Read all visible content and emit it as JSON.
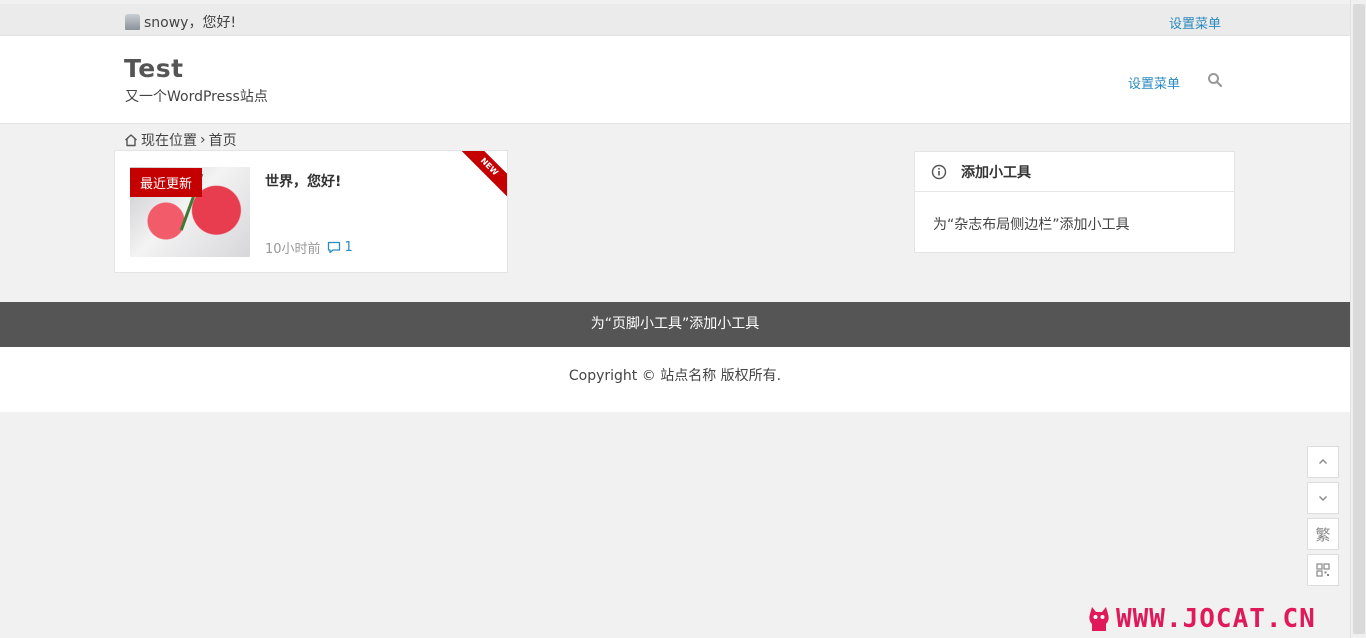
{
  "topbar": {
    "greeting": "snowy，您好!",
    "menu_label": "设置菜单"
  },
  "header": {
    "site_title": "Test",
    "site_description": "又一个WordPress站点",
    "nav_menu_label": "设置菜单"
  },
  "breadcrumb": {
    "current_location": "现在位置",
    "separator": "›",
    "home": "首页"
  },
  "post": {
    "tag": "最近更新",
    "title": "世界，您好!",
    "time": "10小时前",
    "comments": "1",
    "ribbon": "NEW"
  },
  "widget": {
    "title": "添加小工具",
    "body": "为“杂志布局侧边栏”添加小工具"
  },
  "footer": {
    "widgets_text": "为“页脚小工具”添加小工具",
    "copyright": "Copyright ©  站点名称  版权所有."
  },
  "side_buttons": {
    "traditional": "繁"
  },
  "watermark": {
    "text": "WWW.JOCAT.CN"
  },
  "colors": {
    "link": "#2a8ac0",
    "tag_red": "#c40000",
    "footer_dark": "#555555"
  }
}
